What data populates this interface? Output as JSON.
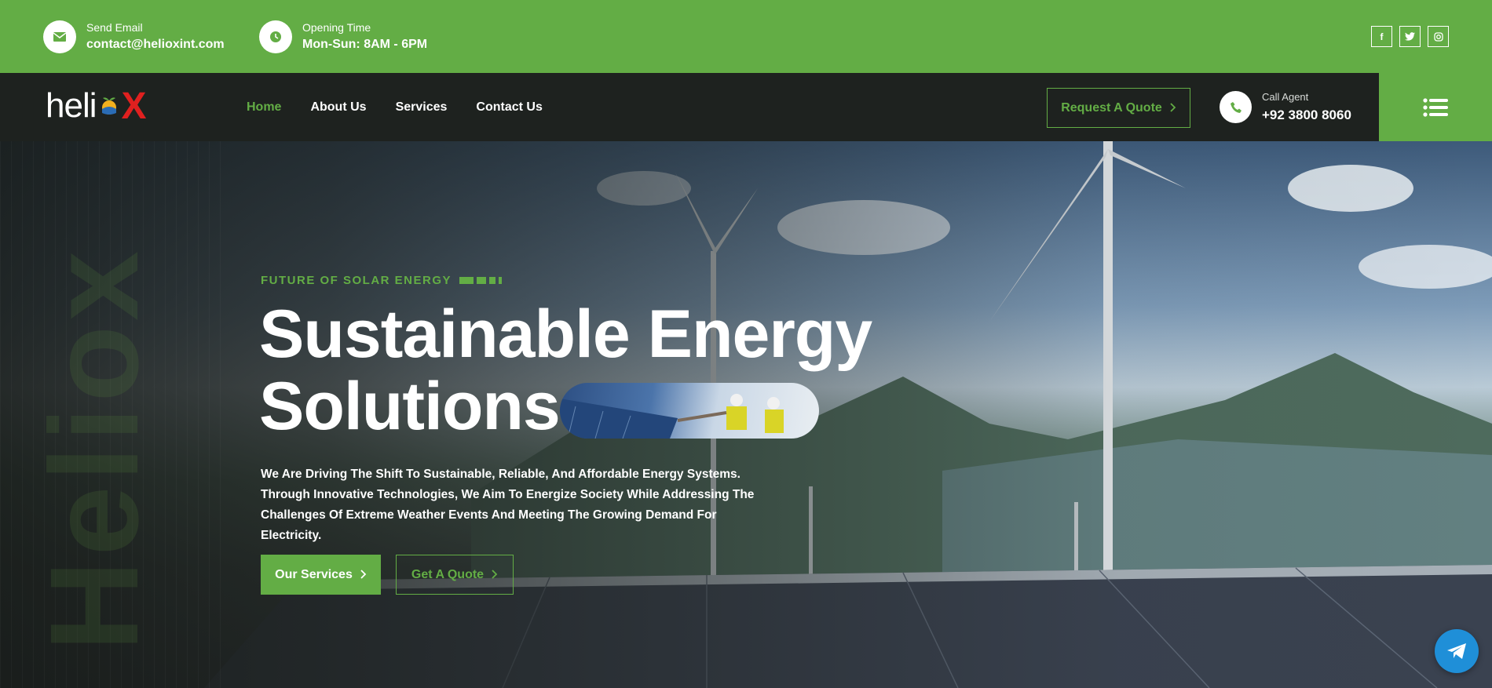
{
  "topbar": {
    "email": {
      "label": "Send Email",
      "value": "contact@helioxint.com",
      "icon": "envelope-icon"
    },
    "hours": {
      "label": "Opening Time",
      "value": "Mon-Sun: 8AM - 6PM",
      "icon": "clock-icon"
    },
    "socials": [
      {
        "name": "facebook-icon",
        "glyph": "f"
      },
      {
        "name": "twitter-icon",
        "glyph": "t"
      },
      {
        "name": "instagram-icon",
        "glyph": "◎"
      }
    ]
  },
  "nav": {
    "logo": {
      "prefix": "heli",
      "x": "X"
    },
    "items": [
      {
        "label": "Home",
        "active": true
      },
      {
        "label": "About Us"
      },
      {
        "label": "Services"
      },
      {
        "label": "Contact Us"
      }
    ],
    "quote_button": "Request A Quote",
    "call": {
      "label": "Call Agent",
      "value": "+92 3800 8060"
    }
  },
  "hero": {
    "watermark": "Heliox",
    "eyebrow": "FUTURE OF SOLAR ENERGY",
    "title_line1": "Sustainable Energy",
    "title_line2": "Solutions",
    "description": "We Are Driving The Shift To Sustainable, Reliable, And Affordable Energy Systems. Through Innovative Technologies, We Aim To Energize Society While Addressing The Challenges Of Extreme Weather Events And Meeting The Growing Demand For Electricity.",
    "primary_button": "Our Services",
    "secondary_button": "Get A Quote"
  },
  "colors": {
    "accent": "#63ad45",
    "dark": "#1e221f",
    "logo_x": "#e0201f",
    "fab": "#1f8fd8"
  }
}
